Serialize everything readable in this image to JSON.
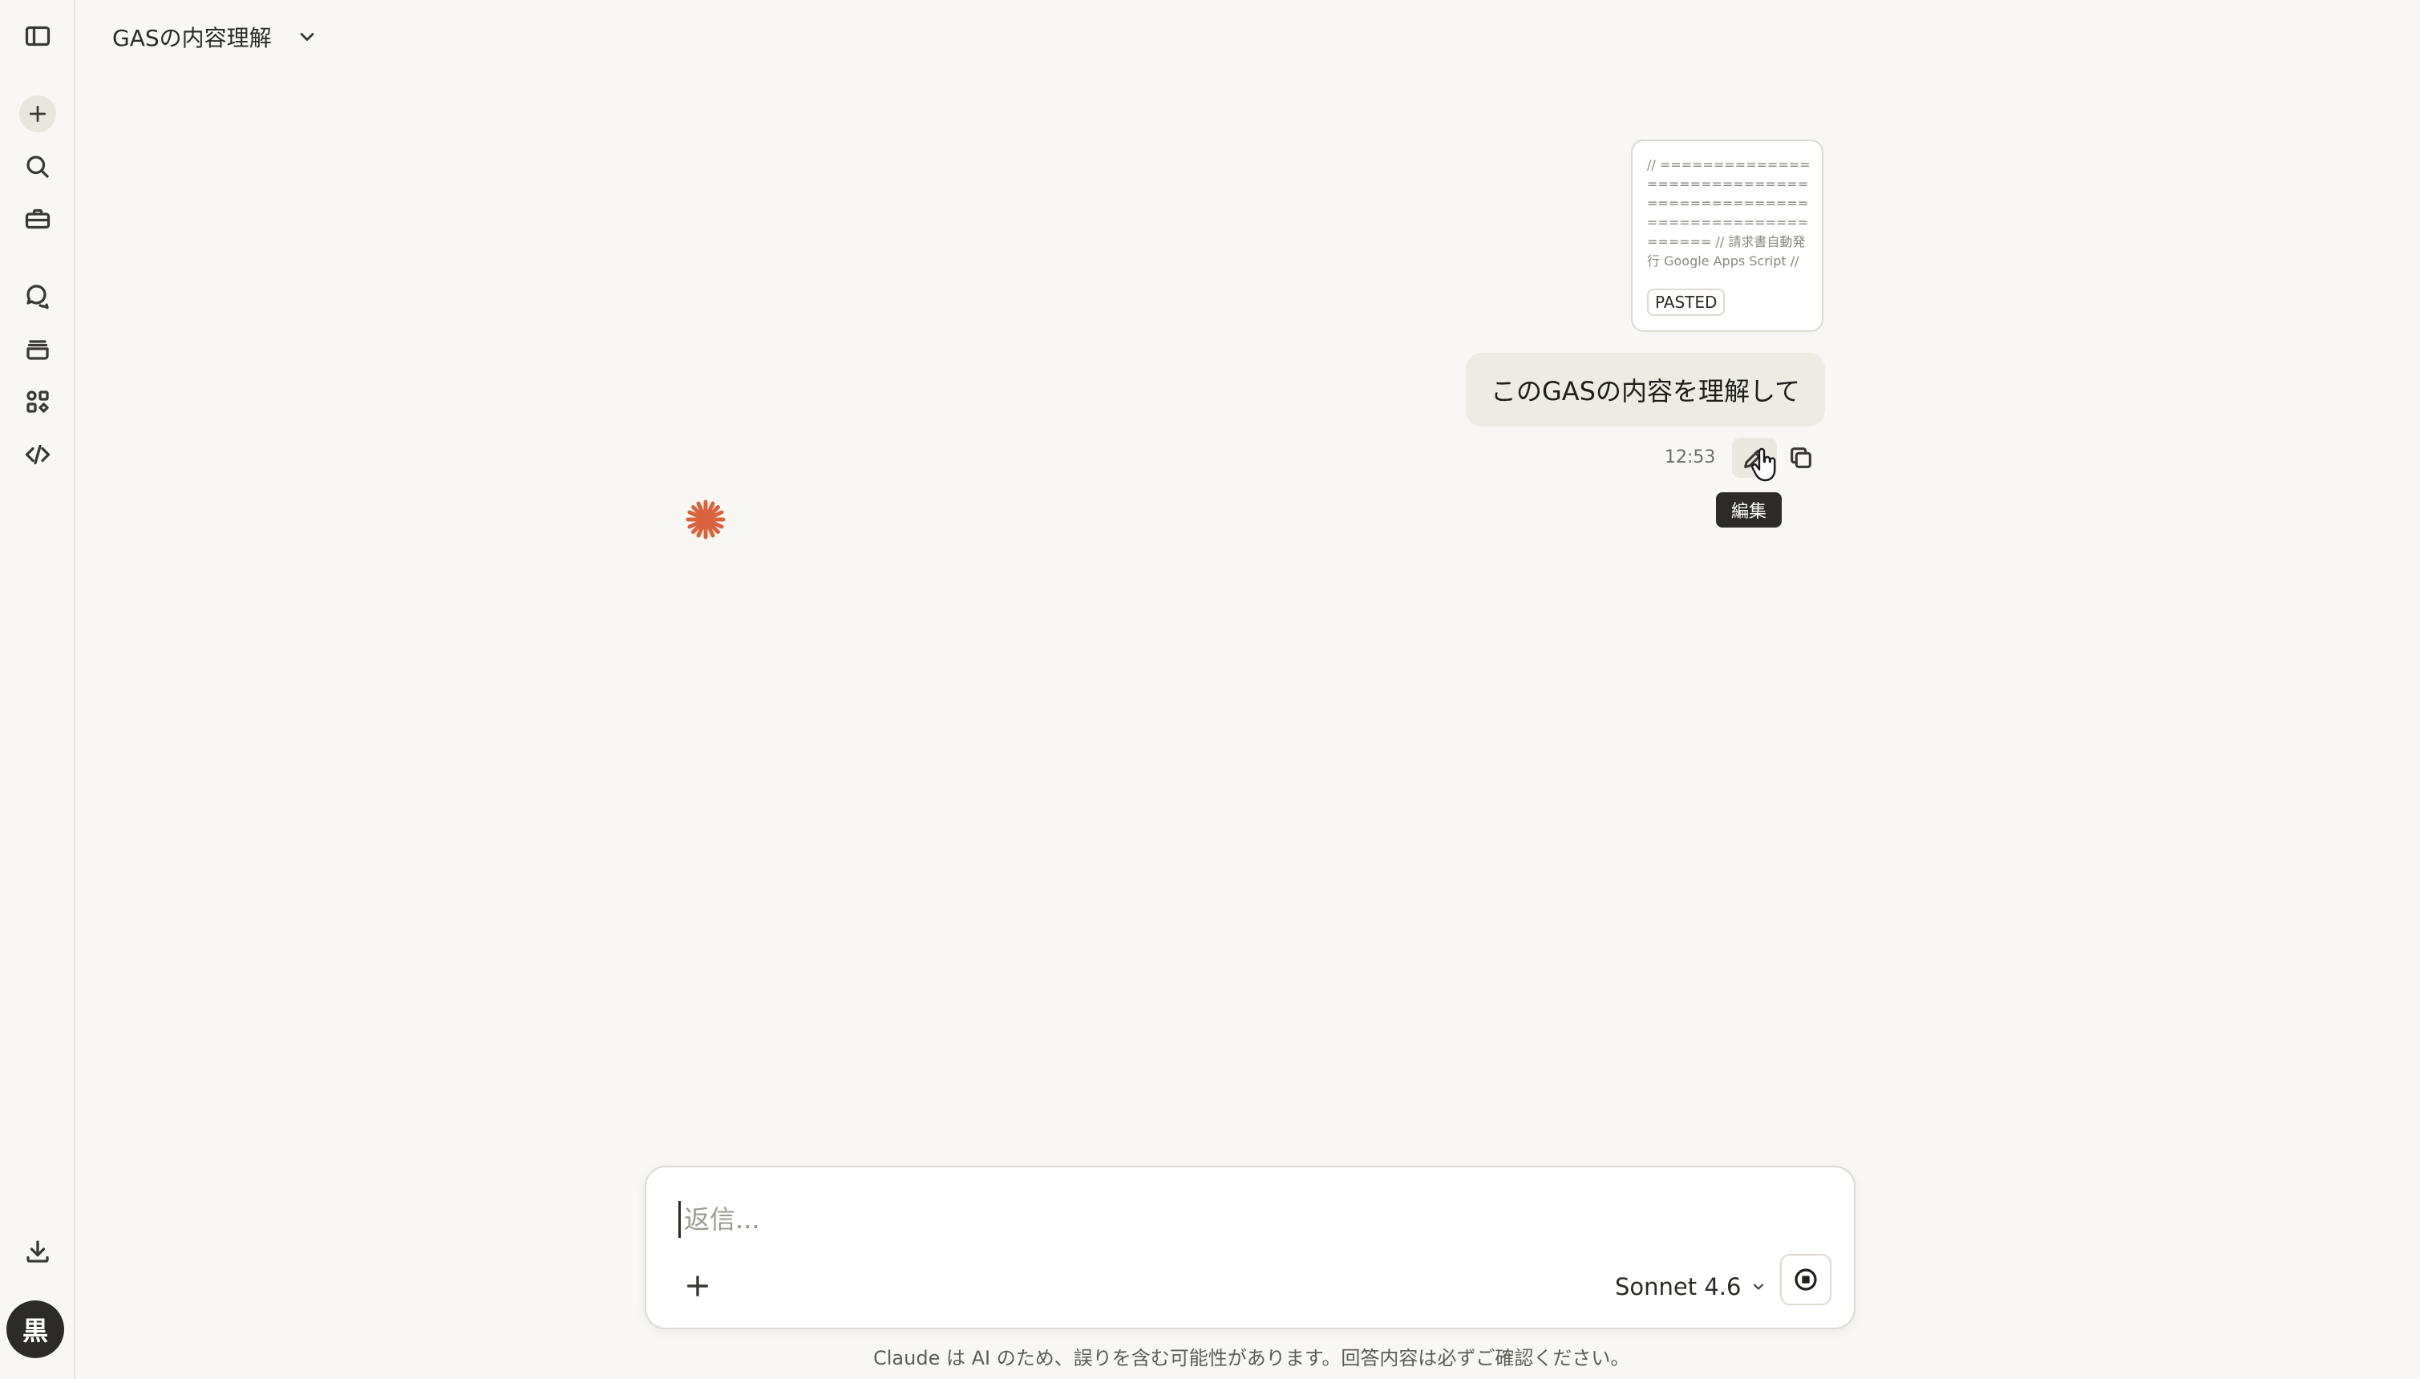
{
  "header": {
    "title": "GASの内容理解"
  },
  "sidebar": {
    "items": [
      {
        "icon": "sidebar-toggle-icon"
      },
      {
        "icon": "plus-icon"
      },
      {
        "icon": "search-icon"
      },
      {
        "icon": "toolbox-icon"
      },
      {
        "icon": "chat-bubbles-icon"
      },
      {
        "icon": "projects-icon"
      },
      {
        "icon": "artifacts-icon"
      },
      {
        "icon": "code-icon"
      },
      {
        "icon": "download-icon"
      }
    ],
    "avatar": "黒"
  },
  "conversation": {
    "pasted": {
      "preview": "// ================================================================= // 請求書自動発行 Google Apps Script // NEXT INNOVAITION株式会社 /...",
      "badge": "PASTED"
    },
    "user_message": "このGASの内容を理解して",
    "time": "12:53",
    "tooltip": "編集"
  },
  "composer": {
    "placeholder": "返信...",
    "model": "Sonnet 4.6"
  },
  "footer": {
    "disclaimer": "Claude は AI のため、誤りを含む可能性があります。回答内容は必ずご確認ください。"
  },
  "colors": {
    "background": "#f8f7f4",
    "accent": "#d9633f",
    "bubble": "#eeebe5",
    "tooltip": "#2c2b28"
  }
}
